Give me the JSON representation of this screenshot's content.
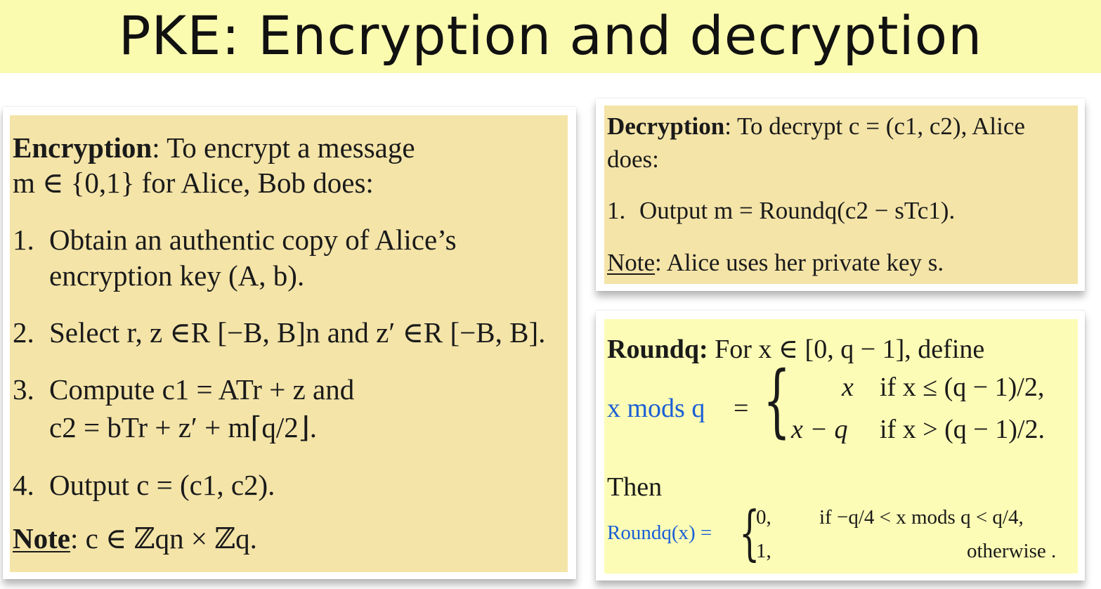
{
  "header": {
    "title": "PKE: Encryption and decryption"
  },
  "encryption": {
    "heading": "Encryption",
    "intro_line1": ": To encrypt a message",
    "intro_line2": "m ∈ {0,1} for Alice, Bob does:",
    "step1_num": "1.",
    "step1_line1": "Obtain an authentic copy of Alice’s",
    "step1_line2": "encryption key (A, b).",
    "step2_num": "2.",
    "step2_text": "Select r, z ∈R [−B, B]n and  z′ ∈R [−B, B].",
    "step3_num": "3.",
    "step3_line1": "Compute c1 = ATr + z  and",
    "step3_line2": "c2 = bTr + z′ + m⌈q/2⌋.",
    "step4_num": "4.",
    "step4_text": "Output c = (c1, c2).",
    "note_label": "Note",
    "note_text": ": c ∈ ℤqn × ℤq."
  },
  "decryption": {
    "heading": "Decryption",
    "intro_line1": ": To decrypt c = (c1, c2), Alice",
    "intro_line2": "does:",
    "step1_num": "1.",
    "step1_text": "Output m = Roundq(c2 − sTc1).",
    "note_label": "Note",
    "note_text": ": Alice uses her private key s."
  },
  "round": {
    "heading": "Roundq:",
    "definition": " For x ∈ [0, q − 1], define",
    "mods_lhs": "x mods q",
    "equals": "=",
    "case1_value": "x",
    "case1_condition": "if x ≤ (q − 1)/2,",
    "case2_value": "x − q",
    "case2_condition": "if x > (q − 1)/2.",
    "then_label": "Then",
    "round_lhs": "Roundq(x) =",
    "round_case1_value": "0,",
    "round_case1_condition": "if −q/4 < x mods q < q/4,",
    "round_case2_value": "1,",
    "round_case2_condition": "otherwise ."
  },
  "colors": {
    "title_band": "#fbfbb0",
    "tan_panel": "#f4e4a8",
    "yellow_panel": "#fcfcb6",
    "accent_blue": "#1a5fd6"
  }
}
